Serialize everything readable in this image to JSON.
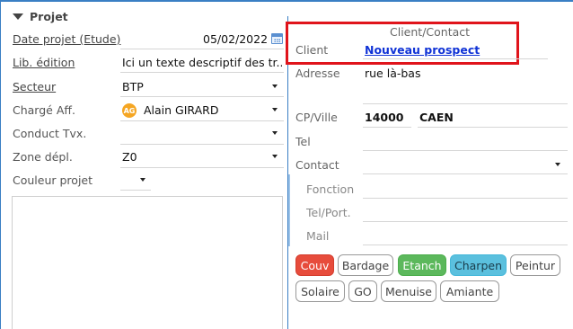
{
  "section": {
    "title": "Projet"
  },
  "left_fields": [
    {
      "label": "Date projet (Etude)",
      "value": "05/02/2022"
    },
    {
      "label": "Lib. édition",
      "value": "Ici un texte descriptif des tr..."
    },
    {
      "label": "Secteur",
      "value": "BTP"
    },
    {
      "label": "Chargé Aff.",
      "value": "Alain GIRARD",
      "avatar_initials": "AG"
    },
    {
      "label": "Conduct Tvx.",
      "value": ""
    },
    {
      "label": "Zone dépl.",
      "value": "Z0"
    },
    {
      "label": "Couleur projet",
      "value": ""
    }
  ],
  "contact": {
    "title": "Client/Contact",
    "client_label": "Client",
    "client_link": "Nouveau prospect",
    "adresse_label": "Adresse",
    "adresse_value": "rue là-bas",
    "cpville_label": "CP/Ville",
    "cp_value": "14000",
    "ville_value": "CAEN",
    "tel_label": "Tel",
    "contact_label": "Contact",
    "fonction_label": "Fonction",
    "telport_label": "Tel/Port.",
    "mail_label": "Mail"
  },
  "tags": [
    {
      "label": "Couv",
      "style": "red",
      "color": "#e74c3c"
    },
    {
      "label": "Bardage",
      "style": "plain"
    },
    {
      "label": "Etanch",
      "style": "green",
      "color": "#5cb85c"
    },
    {
      "label": "Charpen",
      "style": "blue",
      "color": "#5bc0de"
    },
    {
      "label": "Peintur",
      "style": "plain"
    },
    {
      "label": "Solaire",
      "style": "plain"
    },
    {
      "label": "GO",
      "style": "plain"
    },
    {
      "label": "Menuise",
      "style": "plain"
    },
    {
      "label": "Amiante",
      "style": "plain"
    }
  ],
  "colors": {
    "frame": "#3a7fc4",
    "highlight_box": "#e0141b",
    "link": "#1033d6"
  }
}
